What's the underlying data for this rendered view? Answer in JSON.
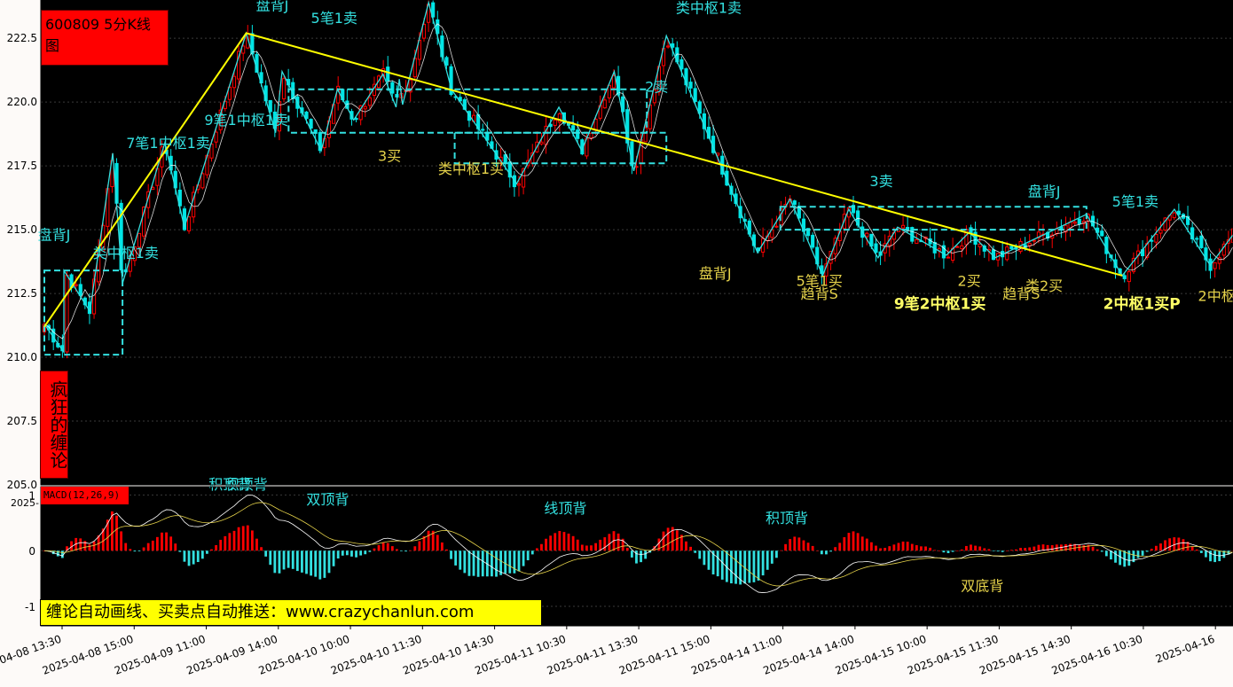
{
  "header": {
    "stock_title": "600809 5分K线图"
  },
  "side_banner": {
    "text": "疯狂的缠论"
  },
  "macd_panel": {
    "label": "MACD(12,26,9)"
  },
  "promo": {
    "text": "缠论自动画线、买卖点自动推送：www.crazychanlun.com"
  },
  "colors": {
    "background": "#000000",
    "up_candle": "#ff0000",
    "down_candle": "#00e5e5",
    "stroke_line": "#33e0e0",
    "segment_line": "#ffff00",
    "cyan_label": "#33e0e0",
    "yellow_label": "#e5d24a",
    "macd_positive": "#ff0000",
    "macd_negative": "#33e0e0",
    "dif_line": "#ffffff",
    "dea_line": "#e5d24a"
  },
  "chart_data": {
    "type": "candlestick",
    "price_axis": {
      "ylim": [
        205.0,
        224.0
      ],
      "ticks": [
        "205.0",
        "207.5",
        "210.0",
        "212.5",
        "215.0",
        "217.5",
        "220.0",
        "222.5"
      ]
    },
    "macd_axis": {
      "ylim": [
        -1.35,
        1.15
      ],
      "ticks": [
        "1",
        "0",
        "-1"
      ],
      "top_label": "2025-"
    },
    "x_labels": [
      "2025-04-08 13:30",
      "2025-04-08 15:00",
      "2025-04-09 11:00",
      "2025-04-09 14:00",
      "2025-04-10 10:00",
      "2025-04-10 11:30",
      "2025-04-10 14:30",
      "2025-04-11 10:30",
      "2025-04-11 13:30",
      "2025-04-11 15:00",
      "2025-04-14 11:00",
      "2025-04-14 14:00",
      "2025-04-15 10:00",
      "2025-04-15 11:30",
      "2025-04-15 14:30",
      "2025-04-16 10:30",
      "2025-04-16"
    ],
    "bar_count": 264,
    "stroke_pivots": [
      [
        0,
        211.3
      ],
      [
        6,
        210.2
      ],
      [
        6,
        213.4
      ],
      [
        14,
        211.8
      ],
      [
        21,
        218.0
      ],
      [
        24,
        212.9
      ],
      [
        37,
        218.4
      ],
      [
        43,
        215.1
      ],
      [
        62,
        222.7
      ],
      [
        71,
        218.8
      ],
      [
        73,
        221.2
      ],
      [
        85,
        218.1
      ],
      [
        90,
        220.5
      ],
      [
        95,
        219.3
      ],
      [
        104,
        221.1
      ],
      [
        108,
        219.8
      ],
      [
        109,
        220.9
      ],
      [
        110,
        219.9
      ],
      [
        118,
        223.9
      ],
      [
        125,
        220.5
      ],
      [
        145,
        216.8
      ],
      [
        158,
        219.8
      ],
      [
        165,
        218.1
      ],
      [
        175,
        221.2
      ],
      [
        181,
        217.3
      ],
      [
        191,
        222.6
      ],
      [
        219,
        214.1
      ],
      [
        229,
        216.2
      ],
      [
        239,
        213.2
      ],
      [
        247,
        215.8
      ],
      [
        256,
        213.9
      ],
      [
        262,
        215.1
      ],
      [
        277,
        214.0
      ],
      [
        284,
        214.9
      ],
      [
        292,
        213.9
      ],
      [
        320,
        215.6
      ],
      [
        331,
        213.2
      ],
      [
        347,
        215.8
      ],
      [
        358,
        213.6
      ],
      [
        365,
        214.8
      ]
    ],
    "segment_line": [
      [
        0,
        211.2
      ],
      [
        62,
        222.7
      ],
      [
        331,
        213.2
      ]
    ],
    "hub_boxes": [
      {
        "x0": 0,
        "x1": 24,
        "y_top": 213.4,
        "y_bottom": 210.1
      },
      {
        "x0": 75,
        "x1": 185,
        "y_top": 220.5,
        "y_bottom": 218.8
      },
      {
        "x0": 126,
        "x1": 191,
        "y_top": 218.8,
        "y_bottom": 217.6
      },
      {
        "x0": 226,
        "x1": 320,
        "y_top": 215.9,
        "y_bottom": 215.0
      }
    ],
    "annotations": [
      {
        "text": "盘背J",
        "x": 3,
        "y": 214.6,
        "color": "cyan"
      },
      {
        "text": "类中枢1卖",
        "x": 25,
        "y": 213.9,
        "color": "cyan"
      },
      {
        "text": "7笔1中枢1卖",
        "x": 38,
        "y": 218.2,
        "color": "cyan"
      },
      {
        "text": "9笔1中枢1卖",
        "x": 62,
        "y": 219.1,
        "color": "cyan"
      },
      {
        "text": "盘背J",
        "x": 70,
        "y": 223.6,
        "color": "cyan"
      },
      {
        "text": "5笔1卖",
        "x": 89,
        "y": 223.1,
        "color": "cyan"
      },
      {
        "text": "盘背J",
        "x": 131,
        "y": 224.5,
        "color": "cyan"
      },
      {
        "text": "7笔1中枢1卖",
        "x": 149,
        "y": 224.2,
        "color": "cyan"
      },
      {
        "text": "2卖",
        "x": 188,
        "y": 220.4,
        "color": "cyan"
      },
      {
        "text": "类中枢1卖",
        "x": 204,
        "y": 223.5,
        "color": "cyan"
      },
      {
        "text": "3卖",
        "x": 257,
        "y": 216.7,
        "color": "cyan"
      },
      {
        "text": "盘背J",
        "x": 307,
        "y": 216.3,
        "color": "cyan"
      },
      {
        "text": "5笔1卖",
        "x": 335,
        "y": 215.9,
        "color": "cyan"
      },
      {
        "text": "3买",
        "x": 106,
        "y": 217.7,
        "color": "yellow"
      },
      {
        "text": "类中枢1买",
        "x": 131,
        "y": 217.2,
        "color": "yellow"
      },
      {
        "text": "盘背J",
        "x": 206,
        "y": 213.1,
        "color": "yellow"
      },
      {
        "text": "5笔1买",
        "x": 238,
        "y": 212.8,
        "color": "yellow"
      },
      {
        "text": "趋背S",
        "x": 238,
        "y": 212.3,
        "color": "yellow"
      },
      {
        "text": "9笔2中枢1买",
        "x": 275,
        "y": 211.9,
        "color": "yellow",
        "bold": true
      },
      {
        "text": "2买",
        "x": 284,
        "y": 212.8,
        "color": "yellow"
      },
      {
        "text": "趋背S",
        "x": 300,
        "y": 212.3,
        "color": "yellow"
      },
      {
        "text": "类2买",
        "x": 307,
        "y": 212.6,
        "color": "yellow"
      },
      {
        "text": "2中枢1买P",
        "x": 337,
        "y": 211.9,
        "color": "yellow",
        "bold": true
      },
      {
        "text": "2中枢",
        "x": 360,
        "y": 212.2,
        "color": "yellow"
      }
    ],
    "macd_annotations": [
      {
        "text": "积顶背",
        "x": 57,
        "y": 1.1,
        "color": "cyan"
      },
      {
        "text": "积顶背",
        "x": 62,
        "y": 1.1,
        "color": "cyan"
      },
      {
        "text": "双顶背",
        "x": 87,
        "y": 0.83,
        "color": "cyan"
      },
      {
        "text": "线顶背",
        "x": 160,
        "y": 0.67,
        "color": "cyan"
      },
      {
        "text": "积顶背",
        "x": 228,
        "y": 0.5,
        "color": "cyan"
      },
      {
        "text": "双底背",
        "x": 288,
        "y": -0.72,
        "color": "yellow"
      }
    ]
  }
}
